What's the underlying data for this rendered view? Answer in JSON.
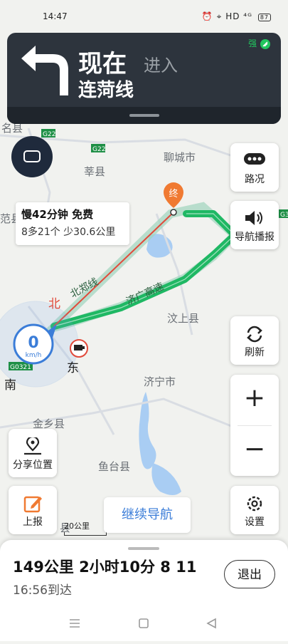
{
  "status_bar": {
    "time": "14:47",
    "icons": "⏰ ⌖ HD ⁴ᴳ",
    "battery": "87"
  },
  "nav_card": {
    "action": "现在",
    "action_suffix": "进入",
    "road": "连菏线",
    "signal_label": "强"
  },
  "traffic_info": {
    "line1": "慢42分钟 免费",
    "line2": "8多21个 少30.6公里"
  },
  "map_labels": {
    "chengxian": "名县",
    "g22_a": "G22",
    "g22_b": "G22",
    "xinxian": "莘县",
    "liaocheng": "聊城市",
    "fanxian": "范县",
    "beizheng": "北郑线",
    "jiguang": "济广高速",
    "wenshang": "汶上县",
    "jining": "济宁市",
    "jinxiang": "金乡县",
    "yutai": "鱼台县",
    "g0321": "G0321",
    "g3": "G3",
    "end_marker": "终",
    "compass_north": "北",
    "compass_east": "东",
    "compass_south": "南",
    "speed_value": "0",
    "speed_unit": "km/h",
    "county_edge": "县"
  },
  "side_buttons": {
    "traffic": "路况",
    "voice": "导航播报",
    "refresh": "刷新",
    "zoom_in": "+",
    "zoom_out": "−",
    "settings": "设置",
    "share_location": "分享位置",
    "report": "上报"
  },
  "scale_label": "20公里",
  "continue_nav": "继续导航",
  "trip": {
    "summary": "149公里 2小时10分 8 11",
    "arrival": "16:56到达",
    "exit": "退出"
  },
  "colors": {
    "route_green": "#1fb864",
    "nav_bg": "#2d343d",
    "accent_blue": "#3b7dd8",
    "end_orange": "#f07a32"
  }
}
